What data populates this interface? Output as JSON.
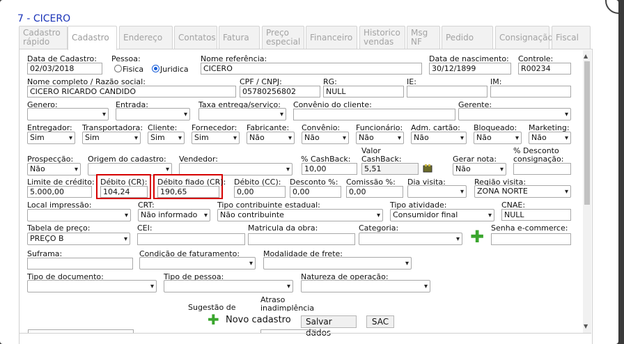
{
  "title": "7 - CICERO",
  "tabs": [
    {
      "name": "cadastro-rapido",
      "label": "Cadastro\nrápido"
    },
    {
      "name": "cadastro",
      "label": "Cadastro"
    },
    {
      "name": "endereco",
      "label": "Endereço"
    },
    {
      "name": "contatos",
      "label": "Contatos"
    },
    {
      "name": "fatura",
      "label": "Fatura"
    },
    {
      "name": "preco-especial",
      "label": "Preço\nespecial"
    },
    {
      "name": "financeiro",
      "label": "Financeiro"
    },
    {
      "name": "historico-vendas",
      "label": "Historico\nvendas"
    },
    {
      "name": "msg-nf",
      "label": "Msg\nNF"
    },
    {
      "name": "pedido",
      "label": "Pedido"
    },
    {
      "name": "consignacao",
      "label": "Consignação"
    },
    {
      "name": "fiscal",
      "label": "Fiscal"
    }
  ],
  "form": {
    "data_cadastro": {
      "label": "Data de Cadastro:",
      "value": "02/03/2018"
    },
    "pessoa": {
      "label": "Pessoa:",
      "fisica": "Fisica",
      "juridica": "Juridica"
    },
    "nome_referencia": {
      "label": "Nome referência:",
      "value": "CICERO"
    },
    "data_nascimento": {
      "label": "Data de nascimento:",
      "value": "30/12/1899"
    },
    "controle": {
      "label": "Controle:",
      "value": "R00234"
    },
    "nome_completo": {
      "label": "Nome completo / Razão social:",
      "value": "CICERO RICARDO CANDIDO"
    },
    "cpf_cnpj": {
      "label": "CPF / CNPJ:",
      "value": "05780256802"
    },
    "rg": {
      "label": "RG:",
      "value": "NULL"
    },
    "ie": {
      "label": "IE:",
      "value": ""
    },
    "im": {
      "label": "IM:",
      "value": ""
    },
    "genero": {
      "label": "Genero:",
      "value": ""
    },
    "entrada": {
      "label": "Entrada:",
      "value": ""
    },
    "taxa_entrega": {
      "label": "Taxa entrega/serviço:",
      "value": ""
    },
    "convenio_cliente": {
      "label": "Convênio do cliente:",
      "value": ""
    },
    "gerente": {
      "label": "Gerente:",
      "value": ""
    },
    "entregador": {
      "label": "Entregador:",
      "value": "Sim"
    },
    "transportadora": {
      "label": "Transportadora:",
      "value": "Sim"
    },
    "cliente": {
      "label": "Cliente:",
      "value": "Sim"
    },
    "fornecedor": {
      "label": "Fornecedor:",
      "value": "Sim"
    },
    "fabricante": {
      "label": "Fabricante:",
      "value": "Não"
    },
    "convenio": {
      "label": "Convênio:",
      "value": "Não"
    },
    "funcionario": {
      "label": "Funcionário:",
      "value": "Não"
    },
    "adm_cartao": {
      "label": "Adm. cartão:",
      "value": "Não"
    },
    "bloqueado": {
      "label": "Bloqueado:",
      "value": "Não"
    },
    "marketing": {
      "label": "Marketing:",
      "value": "Não"
    },
    "prospeccao": {
      "label": "Prospecção:",
      "value": "Não"
    },
    "origem_cadastro": {
      "label": "Origem do cadastro:",
      "value": ""
    },
    "vendedor": {
      "label": "Vendedor:",
      "value": ""
    },
    "pct_cashback": {
      "label": "% CashBack:",
      "value": "10,00"
    },
    "valor_cashback": {
      "label": "Valor\nCashBack:",
      "value": "5,51"
    },
    "gerar_nota": {
      "label": "Gerar nota:",
      "value": "Não"
    },
    "pct_desconto_consignacao": {
      "label": "% Desconto\nconsignação:",
      "value": ""
    },
    "limite_credito": {
      "label": "Limite de crédito:",
      "value": "5.000,00"
    },
    "debito_cr": {
      "label": "Débito (CR):",
      "value": "104,24"
    },
    "debito_fiado_cr": {
      "label": "Débito fiado (CR):",
      "value": "190,65"
    },
    "debito_cc": {
      "label": "Débito (CC):",
      "value": "0,00"
    },
    "desconto_pct": {
      "label": "Desconto %:",
      "value": "0,00"
    },
    "comissao_pct": {
      "label": "Comissão %:",
      "value": "0,00"
    },
    "dia_visita": {
      "label": "Dia visita:",
      "value": ""
    },
    "regiao_visita": {
      "label": "Região visita:",
      "value": "ZONA NORTE"
    },
    "local_impressao": {
      "label": "Local impressão:",
      "value": ""
    },
    "crt": {
      "label": "CRT:",
      "value": "Não informado"
    },
    "tipo_contribuinte": {
      "label": "Tipo contribuinte estadual:",
      "value": "Não contribuinte"
    },
    "tipo_atividade": {
      "label": "Tipo atividade:",
      "value": "Consumidor final"
    },
    "cnae": {
      "label": "CNAE:",
      "value": "NULL"
    },
    "tabela_preco": {
      "label": "Tabela de preço:",
      "value": "PREÇO B"
    },
    "cei": {
      "label": "CEI:",
      "value": ""
    },
    "matricula_obra": {
      "label": "Matricula da obra:",
      "value": ""
    },
    "categoria": {
      "label": "Categoria:",
      "value": ""
    },
    "senha_ecommerce": {
      "label": "Senha e-commerce:",
      "value": ""
    },
    "suframa": {
      "label": "Suframa:",
      "value": ""
    },
    "condicao_faturamento": {
      "label": "Condição de faturamento:",
      "value": ""
    },
    "modalidade_frete": {
      "label": "Modalidade de frete:",
      "value": ""
    },
    "tipo_documento": {
      "label": "Tipo de documento:",
      "value": ""
    },
    "tipo_pessoa": {
      "label": "Tipo de pessoa:",
      "value": ""
    },
    "natureza_operacao": {
      "label": "Natureza de operação:",
      "value": ""
    },
    "sugestao": {
      "label": "Sugestão de"
    },
    "atraso": {
      "label": "Atraso\ninadimplência"
    }
  },
  "footer": {
    "novo": "Novo cadastro",
    "salvar": "Salvar dados",
    "sac": "SAC"
  },
  "colors": {
    "title": "#1a33b8",
    "highlight": "#d60000",
    "plus": "#3aa62e"
  }
}
